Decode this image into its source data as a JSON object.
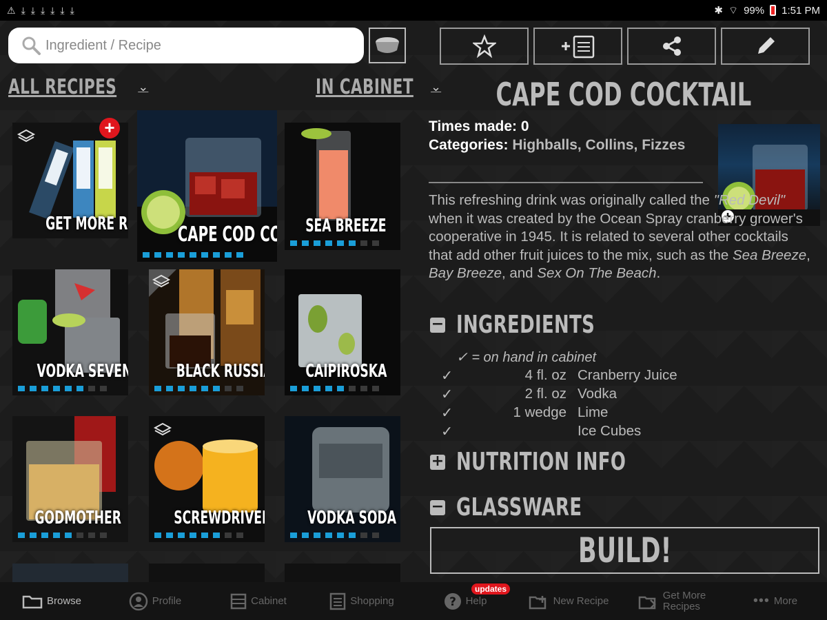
{
  "status": {
    "left_icons": [
      "warning-icon",
      "download-icon",
      "download-icon",
      "download-icon",
      "download-icon",
      "download-icon",
      "download-icon"
    ],
    "battery": "99%",
    "time": "1:51 PM"
  },
  "search": {
    "placeholder": "Ingredient / Recipe"
  },
  "filters": {
    "left": "ALL RECIPES",
    "right": "IN CABINET"
  },
  "tiles": [
    {
      "label": "GET MORE RECIPES"
    },
    {
      "label": "CAPE COD COCKTAIL",
      "dots": 9,
      "on": 9
    },
    {
      "label": "SEA BREEZE",
      "dots": 8,
      "on": 6
    },
    {
      "label": "VODKA SEVEN",
      "dots": 8,
      "on": 6
    },
    {
      "label": "BLACK RUSSIAN",
      "dots": 8,
      "on": 6
    },
    {
      "label": "CAIPIROSKA",
      "dots": 8,
      "on": 5
    },
    {
      "label": "GODMOTHER",
      "dots": 8,
      "on": 5
    },
    {
      "label": "SCREWDRIVER",
      "dots": 8,
      "on": 6
    },
    {
      "label": "VODKA SODA",
      "dots": 8,
      "on": 6
    }
  ],
  "detail": {
    "title": "CAPE COD COCKTAIL",
    "times_made_label": "Times made:",
    "times_made": "0",
    "categories_label": "Categories:",
    "categories": "Highballs, Collins, Fizzes",
    "desc_1": "This refreshing drink was originally called the ",
    "desc_italic_1": "\"Red Devil\"",
    "desc_2": " when it was created by the Ocean Spray cranberry grower's cooperative in 1945. It is related to several other cocktails that add other fruit juices to the mix, such as the ",
    "desc_italic_2": "Sea Breeze",
    "desc_3": ", ",
    "desc_italic_3": "Bay Breeze",
    "desc_4": ", and ",
    "desc_italic_4": "Sex On The Beach",
    "desc_5": ".",
    "sections": {
      "ingredients": "INGREDIENTS",
      "nutrition": "NUTRITION INFO",
      "glassware": "GLASSWARE"
    },
    "legend": "✓ = on hand in cabinet",
    "ingredients": [
      {
        "check": "✓",
        "amount": "4 fl. oz",
        "name": "Cranberry Juice"
      },
      {
        "check": "✓",
        "amount": "2 fl. oz",
        "name": "Vodka"
      },
      {
        "check": "✓",
        "amount": "1 wedge",
        "name": "Lime"
      },
      {
        "check": "✓",
        "amount": "",
        "name": "Ice Cubes"
      }
    ],
    "build": "BUILD!"
  },
  "nav": {
    "browse": "Browse",
    "profile": "Profile",
    "cabinet": "Cabinet",
    "shopping": "Shopping",
    "help": "Help",
    "updates": "updates",
    "new_recipe": "New Recipe",
    "get_more_1": "Get More",
    "get_more_2": "Recipes",
    "more": "More"
  },
  "colors": {
    "accent_blue": "#1a9ed8",
    "badge_red": "#e0161d"
  }
}
